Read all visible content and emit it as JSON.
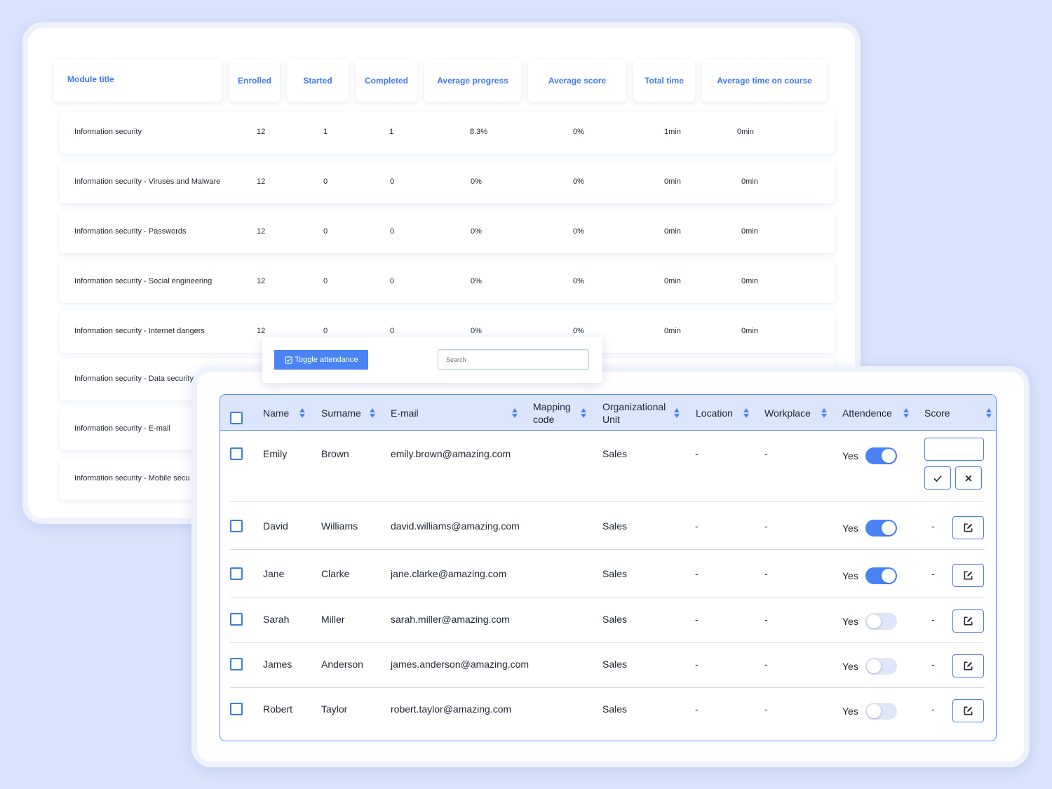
{
  "modules_table": {
    "headers": [
      "Module title",
      "Enrolled",
      "Started",
      "Completed",
      "Average progress",
      "Average score",
      "Total time",
      "Average time on course"
    ],
    "rows": [
      [
        "Information security",
        "12",
        "1",
        "1",
        "8.3%",
        "0%",
        "1min",
        "0min"
      ],
      [
        "Information security - Viruses and Malware",
        "12",
        "0",
        "0",
        "0%",
        "0%",
        "0min",
        "0min"
      ],
      [
        "Information security - Passwords",
        "12",
        "0",
        "0",
        "0%",
        "0%",
        "0min",
        "0min"
      ],
      [
        "Information security - Social engineering",
        "12",
        "0",
        "0",
        "0%",
        "0%",
        "0min",
        "0min"
      ],
      [
        "Information security - Internet dangers",
        "12",
        "0",
        "0",
        "0%",
        "0%",
        "0min",
        "0min"
      ],
      [
        "Information security - Data security"
      ],
      [
        "Information security - E-mail"
      ],
      [
        "Information security - Mobile secu"
      ]
    ]
  },
  "toolbar": {
    "toggle_label": "Toggle attendance",
    "search_placeholder": "Search"
  },
  "attendance_table": {
    "headers": {
      "name": "Name",
      "surname": "Surname",
      "email": "E-mail",
      "mapping_line1": "Mapping",
      "mapping_line2": "code",
      "org_line1": "Organizational",
      "org_line2": "Unit",
      "location": "Location",
      "workplace": "Workplace",
      "attendence": "Attendence",
      "score": "Score"
    },
    "rows": [
      {
        "name": "Emily",
        "surname": "Brown",
        "email": "emily.brown@amazing.com",
        "unit": "Sales",
        "location": "-",
        "workplace": "-",
        "attendance": "Yes",
        "toggle_on": true,
        "score": ""
      },
      {
        "name": "David",
        "surname": "Williams",
        "email": "david.williams@amazing.com",
        "unit": "Sales",
        "location": "-",
        "workplace": "-",
        "attendance": "Yes",
        "toggle_on": true,
        "score": "-"
      },
      {
        "name": "Jane",
        "surname": "Clarke",
        "email": "jane.clarke@amazing.com",
        "unit": "Sales",
        "location": "-",
        "workplace": "-",
        "attendance": "Yes",
        "toggle_on": true,
        "score": "-"
      },
      {
        "name": "Sarah",
        "surname": "Miller",
        "email": "sarah.miller@amazing.com",
        "unit": "Sales",
        "location": "-",
        "workplace": "-",
        "attendance": "Yes",
        "toggle_on": false,
        "score": "-"
      },
      {
        "name": "James",
        "surname": "Anderson",
        "email": "james.anderson@amazing.com",
        "unit": "Sales",
        "location": "-",
        "workplace": "-",
        "attendance": "Yes",
        "toggle_on": false,
        "score": "-"
      },
      {
        "name": "Robert",
        "surname": "Taylor",
        "email": "robert.taylor@amazing.com",
        "unit": "Sales",
        "location": "-",
        "workplace": "-",
        "attendance": "Yes",
        "toggle_on": false,
        "score": "-"
      }
    ]
  },
  "colors": {
    "background": "#d9e3fb",
    "accent": "#4a84f4",
    "header_text": "#3d7be6",
    "table_header_bg": "#dbe6fd"
  }
}
